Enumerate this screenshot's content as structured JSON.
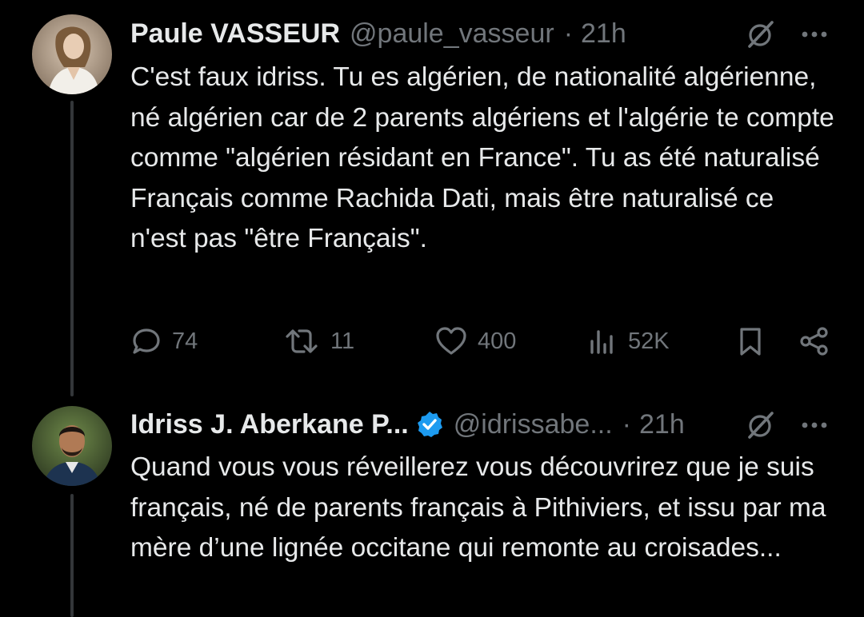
{
  "tweets": [
    {
      "name": "Paule VASSEUR",
      "handle": "@paule_vasseur",
      "separator": "·",
      "time": "21h",
      "verified": false,
      "text": "C'est faux idriss. Tu es algérien, de nationalité algérienne, né algérien car de 2 parents algériens et l'algérie te compte comme \"algérien résidant en France\". Tu as été naturalisé Français comme Rachida Dati, mais être naturalisé ce n'est pas \"être Français\".",
      "stats": {
        "replies": "74",
        "reposts": "11",
        "likes": "400",
        "views": "52K"
      }
    },
    {
      "name": "Idriss J. Aberkane P...",
      "handle": "@idrissabe...",
      "separator": "·",
      "time": "21h",
      "verified": true,
      "text": "Quand vous vous réveillerez vous découvrirez que je suis français, né de parents français à Pithiviers, et issu par ma mère d’une lignée occitane qui remonte au croisades..."
    }
  ],
  "icons": {
    "reply": "speech-bubble-icon",
    "repost": "repost-arrows-icon",
    "like": "heart-icon",
    "views": "bar-chart-icon",
    "bookmark": "bookmark-icon",
    "share": "share-icon",
    "grok": "grok-slash-circle-icon",
    "more": "more-dots-icon",
    "verified": "verified-badge-icon"
  },
  "colors": {
    "background": "#000000",
    "text_primary": "#e7e9ea",
    "text_secondary": "#71767b",
    "verified_blue": "#1d9bf0",
    "thread_line": "#333639"
  }
}
